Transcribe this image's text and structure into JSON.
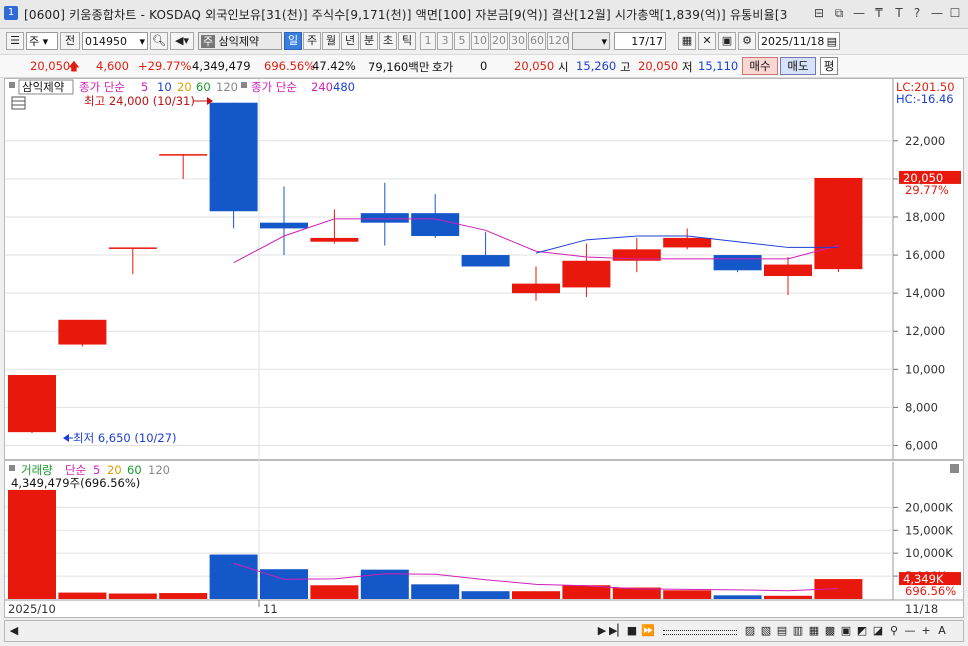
{
  "window": {
    "code": "1",
    "title": "[0600] 키움종합차트 - KOSDAQ 외국인보유[31(천)] 주식수[9,171(천)] 액면[100] 자본금[9(억)] 결산[12월] 시가총액[1,839(억)] 유통비율[3"
  },
  "toolbar": {
    "type_select": "주",
    "all_button": "전",
    "stock_code": "014950",
    "stock_name": "삼익제약",
    "period_buttons": [
      "일",
      "주",
      "월",
      "년",
      "분",
      "초",
      "틱"
    ],
    "interval_buttons": [
      "1",
      "3",
      "5",
      "10",
      "20",
      "30",
      "60",
      "120"
    ],
    "page_counter": "17/17",
    "date": "2025/11/18"
  },
  "info": {
    "price": "20,050",
    "change": "4,600",
    "change_pct": "+29.77%",
    "volume": "4,349,479",
    "volume_ratio": "696.56%",
    "turnover": "47.42%",
    "amount": "79,160백만",
    "quote_label": "호가",
    "quote_value": "0",
    "quote_price": "20,050",
    "open_label": "시",
    "open": "15,260",
    "high_label": "고",
    "high": "20,050",
    "low_label": "저",
    "low": "15,110",
    "buy_button": "매수",
    "sell_button": "매도",
    "eval_button": "평"
  },
  "price_panel": {
    "stock_tag": "삼익제약",
    "ma_title": "종가 단순",
    "ma_periods_short": [
      "5",
      "10",
      "20",
      "60",
      "120"
    ],
    "ma_title_long": "종가 단순",
    "ma_periods_long": [
      "240",
      "480"
    ],
    "max_annotation": "최고 24,000 (10/31)",
    "min_annotation": "최저 6,650 (10/27)",
    "lc": "LC:201.50",
    "hc": "HC:-16.46",
    "y_ticks": [
      "22,000",
      "20,000",
      "18,000",
      "16,000",
      "14,000",
      "12,000",
      "10,000",
      "8,000",
      "6,000"
    ],
    "last_price_tag": "20,050",
    "last_pct_tag": "29.77%"
  },
  "volume_panel": {
    "title": "거래량",
    "ma_title": "단순",
    "ma_periods": [
      "5",
      "20",
      "60",
      "120"
    ],
    "current": "4,349,479주(696.56%)",
    "y_ticks": [
      "20,000K",
      "15,000K",
      "10,000K",
      "5,000K"
    ],
    "last_tag": "4,349K",
    "last_pct_tag": "696.56%"
  },
  "x_axis": {
    "labels": [
      "2025/10",
      "11"
    ],
    "right_label": "11/18"
  },
  "colors": {
    "up": "#e8190c",
    "down": "#1457c8",
    "ma5": "#d020b8",
    "ma10": "#1c3fd6",
    "ma20": "#d8a000",
    "ma60": "#1a9a2a",
    "ma120": "#888888",
    "ma240": "#d020b8",
    "ma480": "#1c3fd6"
  },
  "chart_data": {
    "type": "candlestick",
    "price_axis": {
      "min": 5500,
      "max": 24300
    },
    "volume_axis": {
      "min": 0,
      "max": 24000
    },
    "candles": [
      {
        "o": 6700,
        "h": 9700,
        "l": 6650,
        "c": 9700,
        "v": 23800
      },
      {
        "o": 11300,
        "h": 12600,
        "l": 11200,
        "c": 12600,
        "v": 1400
      },
      {
        "o": 16400,
        "h": 16400,
        "l": 15000,
        "c": 16400,
        "v": 1200
      },
      {
        "o": 21300,
        "h": 21300,
        "l": 20000,
        "c": 21300,
        "v": 1300
      },
      {
        "o": 24000,
        "h": 24000,
        "l": 17400,
        "c": 18300,
        "v": 9700
      },
      {
        "o": 17700,
        "h": 19600,
        "l": 16000,
        "c": 17400,
        "v": 6500
      },
      {
        "o": 16700,
        "h": 18400,
        "l": 16600,
        "c": 16900,
        "v": 3000
      },
      {
        "o": 18200,
        "h": 19800,
        "l": 16500,
        "c": 17700,
        "v": 6400
      },
      {
        "o": 18200,
        "h": 19200,
        "l": 16900,
        "c": 17000,
        "v": 3200
      },
      {
        "o": 16000,
        "h": 17200,
        "l": 15400,
        "c": 15400,
        "v": 1700
      },
      {
        "o": 14000,
        "h": 15400,
        "l": 13600,
        "c": 14500,
        "v": 1700
      },
      {
        "o": 14300,
        "h": 16600,
        "l": 13800,
        "c": 15700,
        "v": 3000
      },
      {
        "o": 15700,
        "h": 16900,
        "l": 15100,
        "c": 16300,
        "v": 2500
      },
      {
        "o": 16400,
        "h": 17400,
        "l": 16300,
        "c": 16900,
        "v": 1900
      },
      {
        "o": 16000,
        "h": 16000,
        "l": 15100,
        "c": 15200,
        "v": 800
      },
      {
        "o": 14900,
        "h": 15900,
        "l": 13900,
        "c": 15500,
        "v": 700
      },
      {
        "o": 15260,
        "h": 20050,
        "l": 15110,
        "c": 20050,
        "v": 4349
      }
    ],
    "ma5": [
      null,
      null,
      null,
      null,
      15600,
      17000,
      17900,
      17900,
      17900,
      17300,
      16200,
      15900,
      15800,
      15800,
      15800,
      15800,
      16500
    ],
    "ma10": [
      null,
      null,
      null,
      null,
      null,
      null,
      null,
      null,
      null,
      null,
      16100,
      16800,
      17000,
      17000,
      16700,
      16400,
      16400
    ],
    "vol_ma5": [
      null,
      null,
      null,
      null,
      7800,
      4300,
      4400,
      5500,
      5400,
      4200,
      3200,
      2900,
      2200,
      2100,
      2000,
      1800,
      2300
    ]
  }
}
